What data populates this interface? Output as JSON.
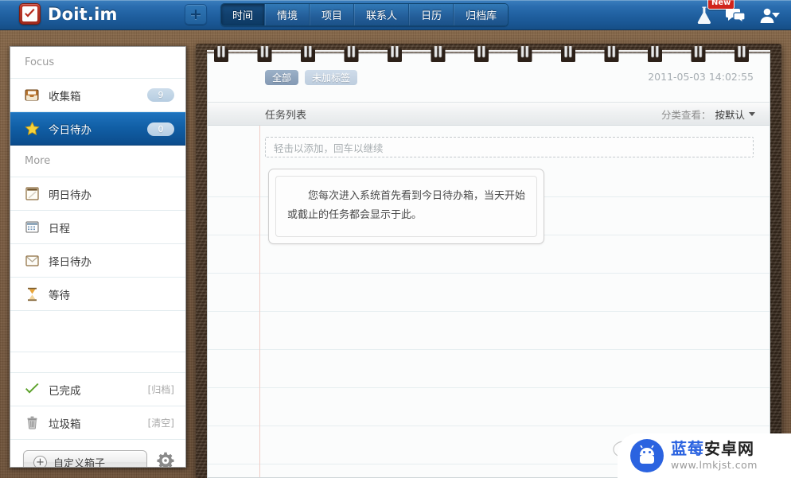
{
  "app": {
    "brand": "Doit.im",
    "logo_icon": "checkbox-check-icon",
    "add_button_label": "+",
    "add_button_icon": "plus-icon"
  },
  "nav": {
    "tabs": [
      {
        "label": "时间",
        "active": true
      },
      {
        "label": "情境",
        "active": false
      },
      {
        "label": "项目",
        "active": false
      },
      {
        "label": "联系人",
        "active": false
      },
      {
        "label": "日历",
        "active": false
      },
      {
        "label": "归档库",
        "active": false
      }
    ]
  },
  "topright": {
    "lab_icon": "flask-icon",
    "new_badge": "New",
    "chat_icon": "speech-bubble-icon",
    "user_icon": "person-icon",
    "caret_icon": "chevron-down-icon"
  },
  "sidebar": {
    "focus_header": "Focus",
    "more_header": "More",
    "focus_items": [
      {
        "label": "收集箱",
        "badge": "9",
        "icon": "inbox-icon",
        "selected": false
      },
      {
        "label": "今日待办",
        "badge": "0",
        "icon": "star-icon",
        "selected": true
      }
    ],
    "more_items": [
      {
        "label": "明日待办",
        "icon": "notepad-icon"
      },
      {
        "label": "日程",
        "icon": "calendar-icon"
      },
      {
        "label": "择日待办",
        "icon": "envelope-icon"
      },
      {
        "label": "等待",
        "icon": "hourglass-icon"
      }
    ],
    "bottom_items": [
      {
        "label": "已完成",
        "action": "[归档]",
        "icon": "green-check-icon"
      },
      {
        "label": "垃圾箱",
        "action": "[清空]",
        "icon": "trash-icon"
      }
    ],
    "custom_button": "自定义箱子",
    "custom_button_icon": "circle-plus-icon",
    "settings_icon": "gear-icon"
  },
  "notepad": {
    "tags": [
      {
        "label": "全部",
        "active": true
      },
      {
        "label": "未加标签",
        "active": false
      }
    ],
    "timestamp": "2011-05-03 14:02:55",
    "list_title": "任务列表",
    "sort_label": "分类查看：",
    "sort_value": "按默认",
    "sort_caret_icon": "chevron-down-icon",
    "add_placeholder": "轻击以添加，回车以继续",
    "tip_text": "您每次进入系统首先看到今日待办箱，当天开始或截止的任务都会显示于此。"
  },
  "watermark": {
    "title_blue": "蓝莓",
    "title_dark": "安卓网",
    "url": "www.lmkjst.com",
    "logo_icon": "android-robot-icon"
  },
  "colors": {
    "topbar_blue": "#1f5f9f",
    "selected_blue": "#115fa6",
    "brand_red": "#a02a1d",
    "leather_brown": "#3f2e20",
    "desk_brown": "#7b5c41",
    "watermark_blue": "#2b63e0"
  }
}
